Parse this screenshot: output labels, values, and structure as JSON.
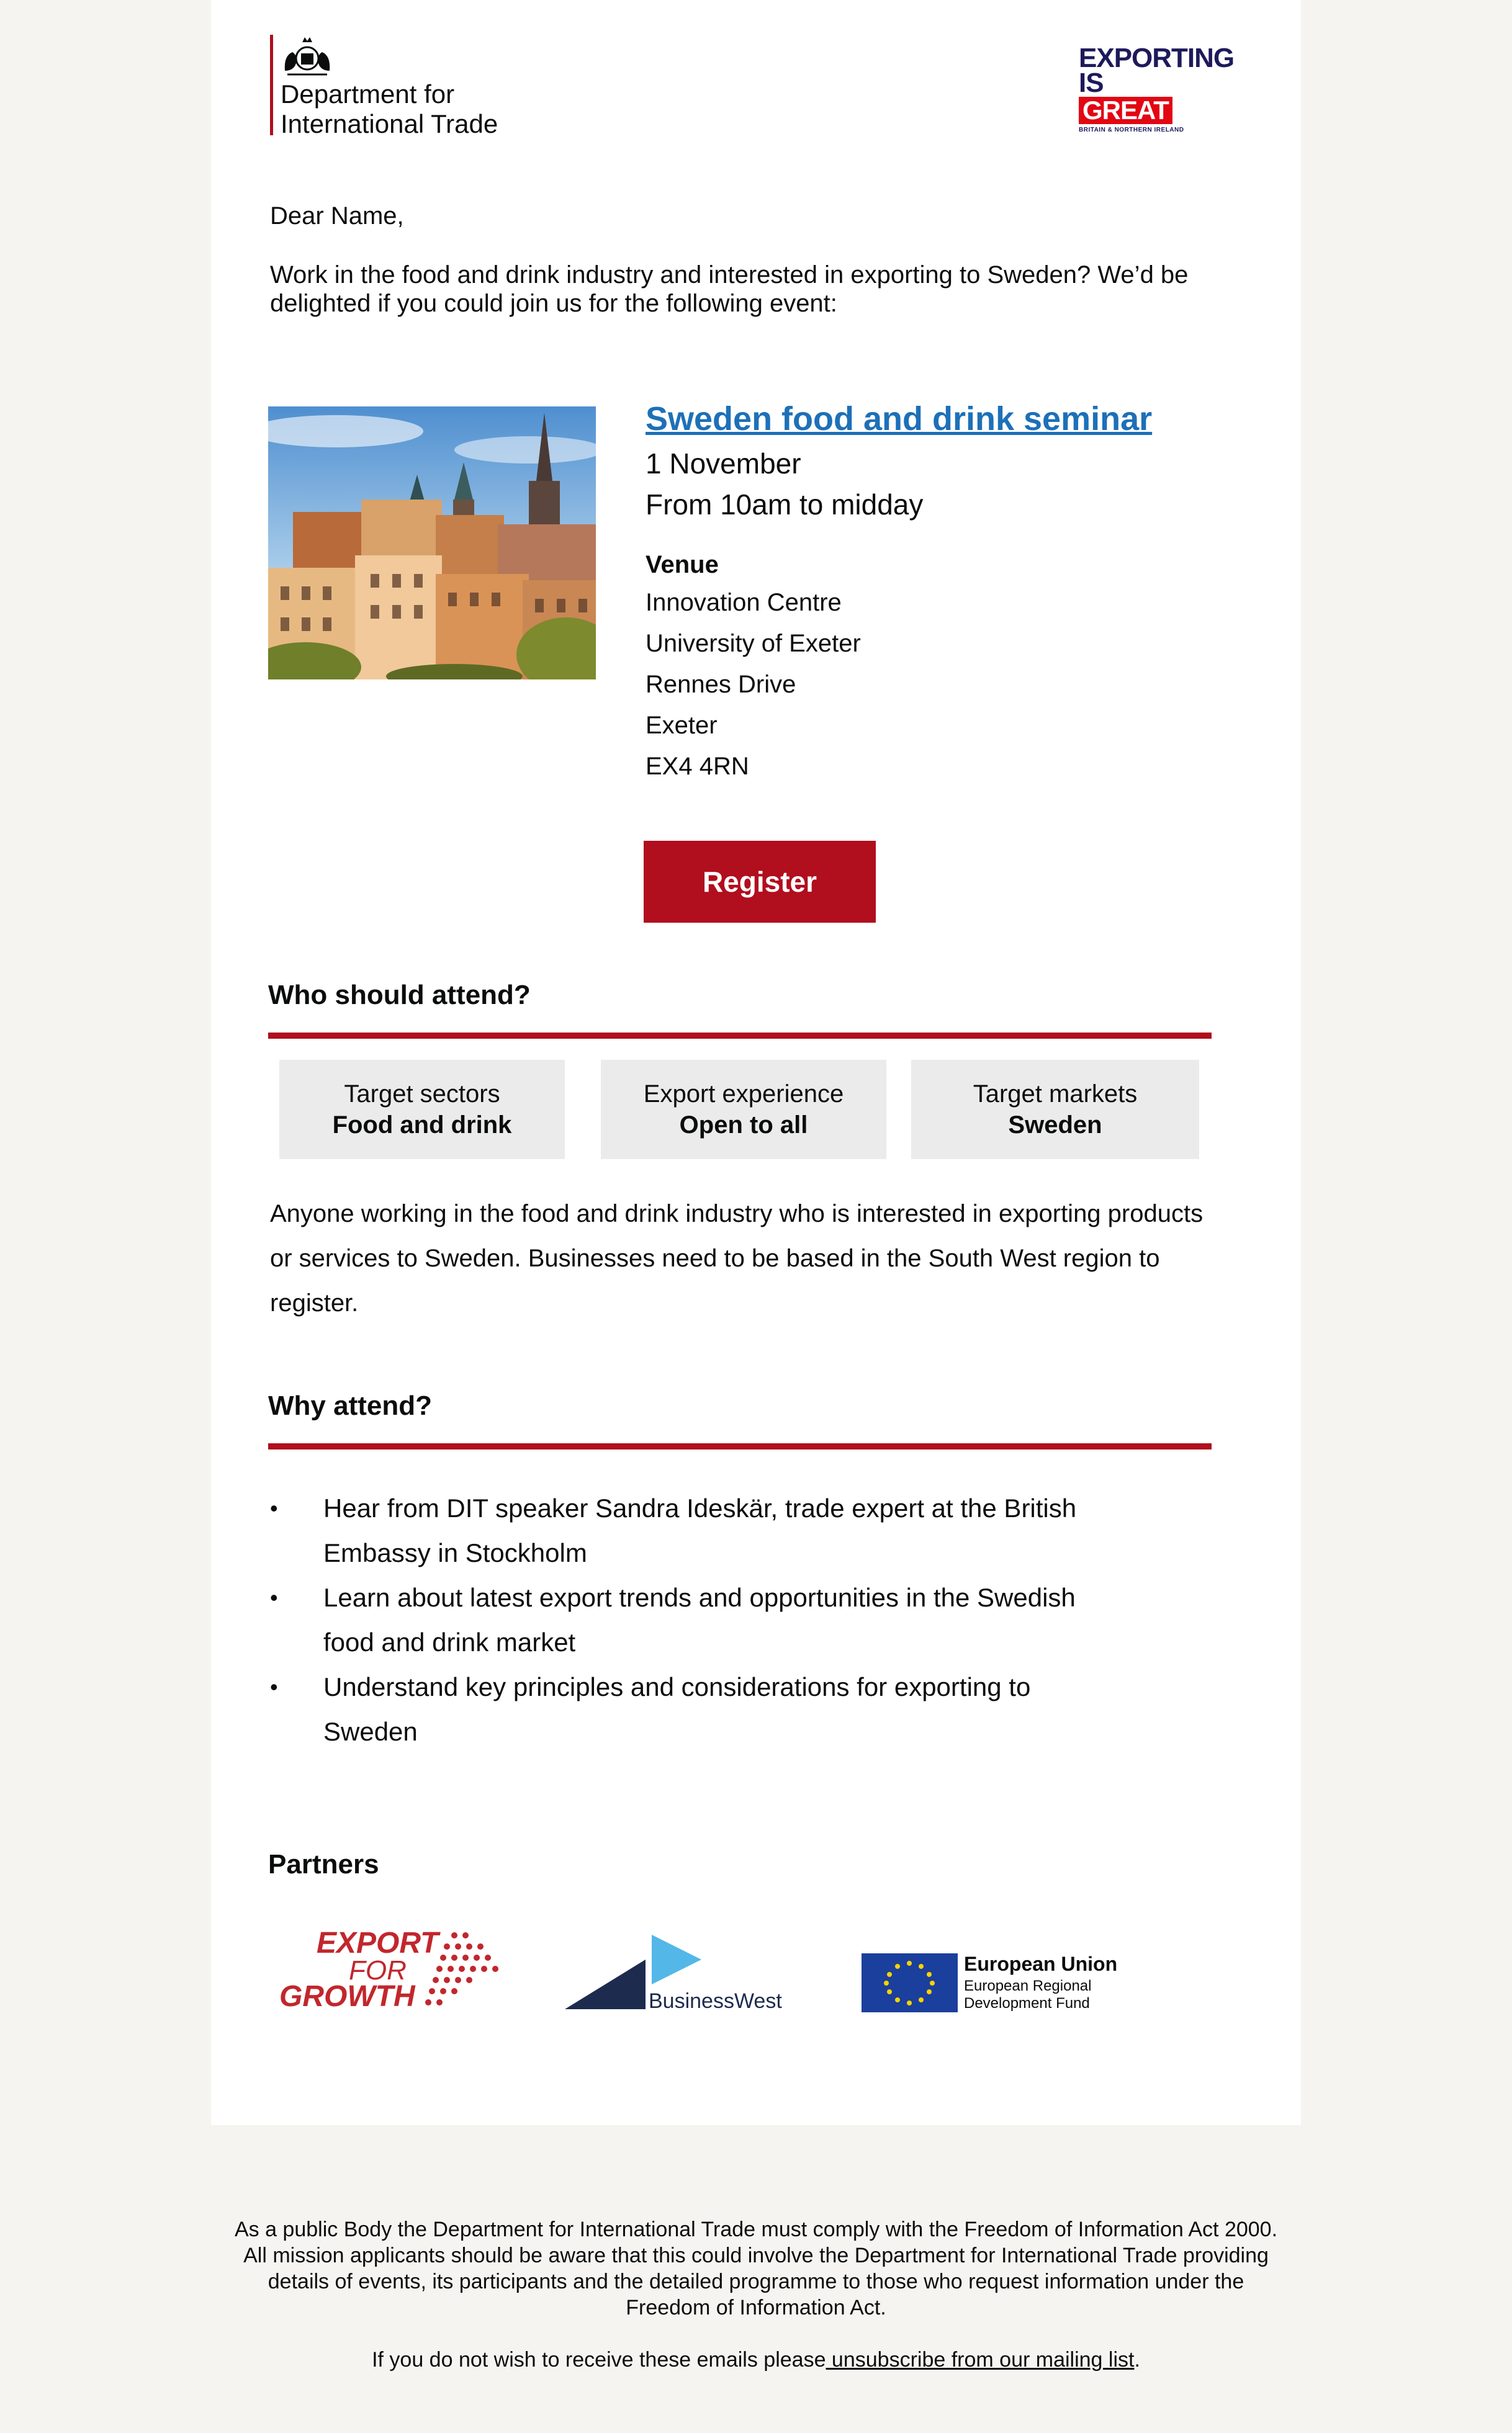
{
  "header": {
    "dit_logo_text": [
      "Department for",
      "International Trade"
    ],
    "eig_logo": {
      "line1": "EXPORTING",
      "line2": "IS",
      "line3": "GREAT",
      "sub": "BRITAIN & NORTHERN IRELAND"
    }
  },
  "greeting": "Dear Name,",
  "intro": "Work in the food and drink industry and interested in exporting to Sweden? We’d be delighted if you could join us for the following event:",
  "event": {
    "title": "Sweden food and drink seminar",
    "date": "1 November",
    "time": "From 10am to midday",
    "venue_heading": "Venue",
    "venue_lines": [
      "Innovation Centre",
      "University of Exeter",
      "Rennes Drive",
      "Exeter",
      "EX4 4RN"
    ],
    "register_label": "Register"
  },
  "who": {
    "heading": "Who should attend?",
    "tags": [
      {
        "label": "Target sectors",
        "value": "Food and drink"
      },
      {
        "label": "Export experience",
        "value": "Open to all"
      },
      {
        "label": "Target markets",
        "value": "Sweden"
      }
    ],
    "text": "Anyone working in the food and drink industry who is interested in exporting products or services to Sweden. Businesses need to be based in the South West region to register."
  },
  "why": {
    "heading": "Why attend?",
    "items": [
      "Hear from DIT speaker Sandra Ideskär, trade expert at the British Embassy in Stockholm",
      "Learn about latest export trends and opportunities in the Swedish food and drink market",
      "Understand key principles and considerations for exporting to Sweden"
    ]
  },
  "partners": {
    "heading": "Partners",
    "efg": [
      "EXPORT",
      "FOR",
      "GROWTH"
    ],
    "bw": "BusinessWest",
    "eu": [
      "European Union",
      "European Regional",
      "Development Fund"
    ]
  },
  "footer": {
    "notice": "As a public Body the Department for International Trade must comply with the Freedom of Information Act 2000. All mission applicants should be aware that this could involve the Department for International Trade providing details of events, its participants and the detailed programme to those who request information under the Freedom of Information Act.",
    "unsub_prefix": "If you do not wish to receive these emails please",
    "unsub_link": " unsubscribe from our mailing list",
    "unsub_suffix": "."
  }
}
